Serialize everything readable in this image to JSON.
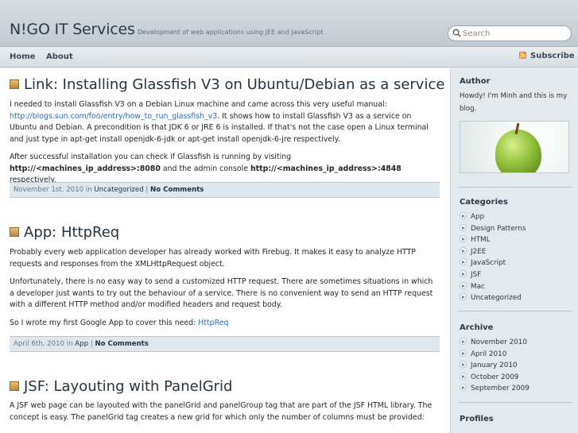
{
  "header": {
    "title": "N!GO IT Services",
    "description": "Development of web applications using JEE and JavaScript",
    "search_placeholder": "Search"
  },
  "nav": {
    "items": [
      {
        "label": "Home"
      },
      {
        "label": "About"
      }
    ],
    "subscribe": "Subscribe"
  },
  "posts": [
    {
      "title": "Link: Installing Glassfish V3 on Ubuntu/Debian as a service",
      "p1_a": "I needed to install Glassfish V3 on a Debian Linux machine and came across this very useful manual:",
      "p1_link": "http://blogs.sun.com/foo/entry/how_to_run_glassfish_v3",
      "p1_b": ". It shows how to install Glassfish V3 as a service on Ubuntu and Debian. A precondition is that JDK 6 or JRE 6 is installed. If that's not the case open a Linux terminal and just type in apt-get install openjdk-6-jdk or apt-get install openjdk-6-jre respectively.",
      "p2_a": "After successful installation you can check if Glassfish is running by visiting ",
      "p2_b1": "http://<machines_ip_address>:8080",
      "p2_c": " and the admin console ",
      "p2_b2": "http://<machines_ip_address>:4848",
      "p2_d": " respectively.",
      "date": "November 1st, 2010 in",
      "category": "Uncategorized",
      "sep": "|",
      "comments": "No Comments"
    },
    {
      "title": "App: HttpReq",
      "p1": "Probably every web application developer has already worked with Firebug. It makes it easy to analyze HTTP requests and responses from the XMLHttpRequest object.",
      "p2": "Unfortunately, there is no easy way to send a customized HTTP request. There are sometimes situations in which a developer just wants to try out the behaviour of a service. There is no convenient way to send an HTTP request with a different HTTP method and/or modified headers and request body.",
      "p3_a": "So I wrote my first Google App to cover this need: ",
      "p3_link": "HttpReq",
      "date": "April 6th, 2010 in",
      "category": "App",
      "sep": "|",
      "comments": "No Comments"
    },
    {
      "title": "JSF: Layouting with PanelGrid",
      "p1": "A JSF web page can be layouted with the panelGrid and panelGroup tag that are part of the JSF HTML library. The concept is easy. The panelGrid tag creates a new grid for which only the number of columns must be provided:"
    }
  ],
  "sidebar": {
    "author_heading": "Author",
    "author_text": "Howdy! I'm Minh and this is my blog.",
    "categories_heading": "Categories",
    "categories": [
      {
        "label": "App"
      },
      {
        "label": "Design Patterns"
      },
      {
        "label": "HTML"
      },
      {
        "label": "J2EE"
      },
      {
        "label": "JavaScript"
      },
      {
        "label": "JSF"
      },
      {
        "label": "Mac"
      },
      {
        "label": "Uncategorized"
      }
    ],
    "archive_heading": "Archive",
    "archive": [
      {
        "label": "November 2010"
      },
      {
        "label": "April 2010"
      },
      {
        "label": "January 2010"
      },
      {
        "label": "October 2009"
      },
      {
        "label": "September 2009"
      }
    ],
    "profiles_heading": "Profiles"
  },
  "colors": {
    "link": "#2f6ab0",
    "meta_bar": "#dfe7ee",
    "sidebar_bg": "#e4e9ed",
    "header_bg": "#c2cad1"
  }
}
